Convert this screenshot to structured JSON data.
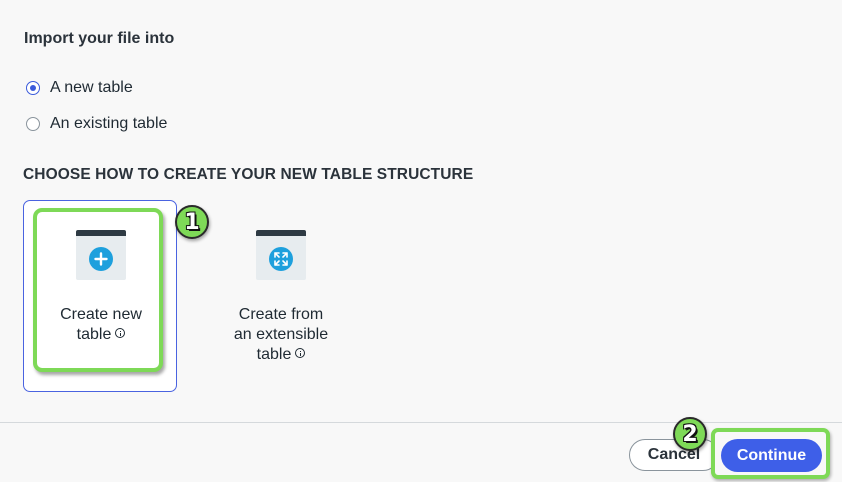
{
  "import": {
    "title": "Import your file into",
    "options": [
      {
        "label": "A new table",
        "selected": true
      },
      {
        "label": "An existing table",
        "selected": false
      }
    ]
  },
  "structure": {
    "heading": "CHOOSE HOW TO CREATE YOUR NEW TABLE STRUCTURE",
    "cards": [
      {
        "line1": "Create new",
        "line2": "table",
        "icon": "plus-icon",
        "selected": true
      },
      {
        "line1": "Create from",
        "line2": "an extensible",
        "line3": "table",
        "icon": "expand-icon",
        "selected": false
      }
    ]
  },
  "annotations": {
    "step1": "1",
    "step2": "2"
  },
  "footer": {
    "cancel_label": "Cancel",
    "continue_label": "Continue"
  },
  "colors": {
    "accent": "#3e5fe8",
    "highlight": "#7ed957",
    "icon_blue": "#1ea0dd"
  }
}
